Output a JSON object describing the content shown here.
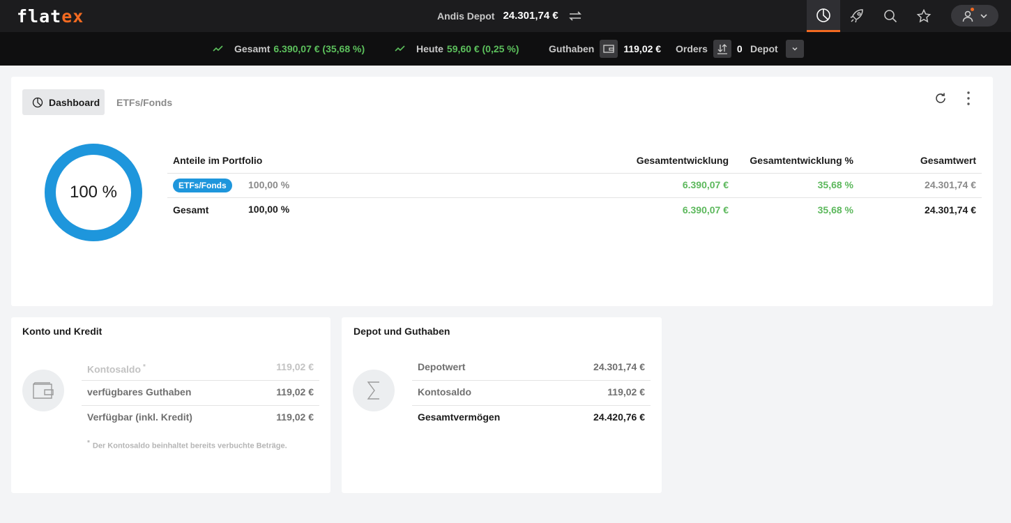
{
  "header": {
    "logo_main": "flat",
    "logo_accent": "ex",
    "depot_name": "Andis Depot",
    "depot_value": "24.301,74 €"
  },
  "statusbar": {
    "gesamt_label": "Gesamt",
    "gesamt_value": "6.390,07 € (35,68 %)",
    "heute_label": "Heute",
    "heute_value": "59,60 € (0,25 %)",
    "guthaben_label": "Guthaben",
    "guthaben_value": "119,02 €",
    "orders_label": "Orders",
    "orders_value": "0",
    "depot_label": "Depot"
  },
  "dashboard": {
    "tabs": [
      {
        "label": "Dashboard"
      },
      {
        "label": "ETFs/Fonds"
      }
    ],
    "donut_label": "100 %",
    "donut_fraction": 1.0,
    "table": {
      "headers": [
        "Anteile im Portfolio",
        "Gesamtentwicklung",
        "Gesamtentwicklung %",
        "Gesamtwert"
      ],
      "rows": [
        {
          "name": "ETFs/Fonds",
          "share": "100,00 %",
          "entwicklung": "6.390,07 €",
          "entwicklung_pct": "35,68 %",
          "wert": "24.301,74 €"
        },
        {
          "name": "Gesamt",
          "share": "100,00 %",
          "entwicklung": "6.390,07 €",
          "entwicklung_pct": "35,68 %",
          "wert": "24.301,74 €"
        }
      ]
    }
  },
  "konto": {
    "title": "Konto und Kredit",
    "rows": [
      {
        "label": "Kontosaldo",
        "star": "*",
        "value": "119,02 €"
      },
      {
        "label": "verfügbares Guthaben",
        "value": "119,02 €"
      },
      {
        "label": "Verfügbar (inkl. Kredit)",
        "value": "119,02 €"
      }
    ],
    "footnote_star": "*",
    "footnote": "Der Kontosaldo beinhaltet bereits verbuchte Beträge."
  },
  "depot": {
    "title": "Depot und Guthaben",
    "rows": [
      {
        "label": "Depotwert",
        "value": "24.301,74 €"
      },
      {
        "label": "Kontosaldo",
        "value": "119,02 €"
      },
      {
        "label": "Gesamtvermögen",
        "value": "24.420,76 €"
      }
    ]
  },
  "colors": {
    "accent": "#f26a21",
    "positive": "#5cb85c",
    "donut": "#1e96dc",
    "topbar": "#1c1c1e"
  },
  "icons": {
    "nav": [
      "portfolio-pie-icon",
      "rocket-icon",
      "search-icon",
      "star-icon",
      "user-icon"
    ]
  }
}
